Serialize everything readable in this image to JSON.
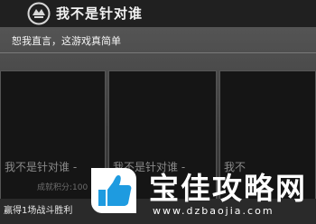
{
  "header": {
    "title": "我不是针对谁",
    "logo_icon": "controller-logo-icon"
  },
  "subtitle": "恕我直言，这游戏真简单",
  "cards": [
    {
      "title": "我不是针对谁 -",
      "score": "成就积分:100"
    },
    {
      "title": "我不是针对谁 -"
    },
    {
      "title": "我不"
    }
  ],
  "footer": {
    "achievement": "赢得1场战斗胜利"
  },
  "watermark": {
    "name": "宝佳攻略网",
    "url": "www.dzbaojia.com",
    "icon": "thumbs-up-icon",
    "brand_color": "#1e9be0"
  }
}
